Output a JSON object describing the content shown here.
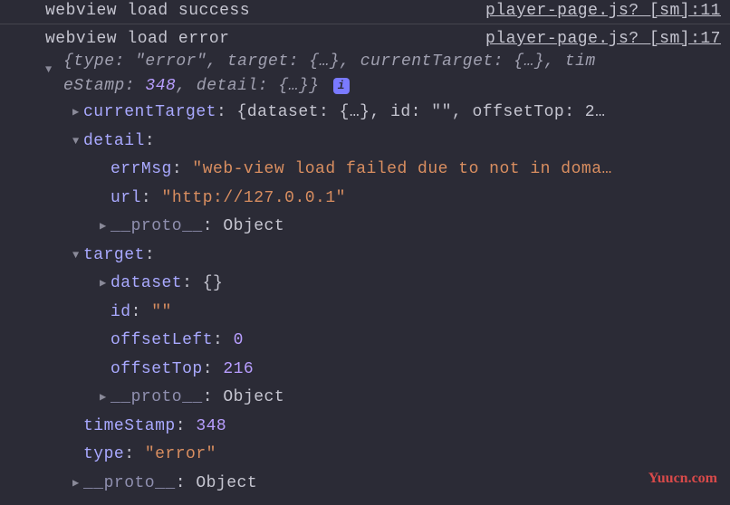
{
  "log1": {
    "message": "webview load success",
    "source": "player-page.js? [sm]:11"
  },
  "log2": {
    "message": "webview load error",
    "source": "player-page.js? [sm]:17",
    "preview_line1": "{type: \"error\", target: {…}, currentTarget: {…}, tim",
    "preview_line2_a": "eStamp: ",
    "preview_line2_b": "348",
    "preview_line2_c": ", detail: {…}}",
    "currentTarget_preview": "{dataset: {…}, id: \"\", offsetTop: 2…",
    "detail": {
      "errMsg": "\"web-view load failed due to not in doma…",
      "url": "\"http://127.0.0.1\"",
      "proto": "Object"
    },
    "target": {
      "dataset": "{}",
      "id": "\"\"",
      "offsetLeft": "0",
      "offsetTop": "216",
      "proto": "Object"
    },
    "timeStamp": "348",
    "type": "\"error\"",
    "proto": "Object"
  },
  "labels": {
    "currentTarget": "currentTarget",
    "detail": "detail",
    "errMsg": "errMsg",
    "url": "url",
    "proto": "__proto__",
    "target": "target",
    "dataset": "dataset",
    "id": "id",
    "offsetLeft": "offsetLeft",
    "offsetTop": "offsetTop",
    "timeStamp": "timeStamp",
    "type": "type",
    "info_badge": "i"
  },
  "watermark": "Yuucn.com"
}
